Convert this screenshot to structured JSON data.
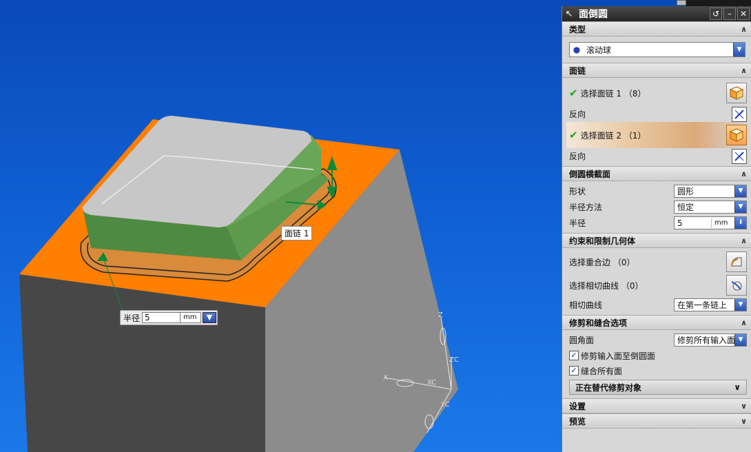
{
  "viewport": {
    "callout_label": "面链 1",
    "radius_label": "半径",
    "radius_value": "5",
    "radius_unit": "mm",
    "axis_labels": {
      "z": "Z",
      "zc": "ZC",
      "x": "X",
      "xc": "XC",
      "yc": "YC"
    },
    "colors": {
      "background": "#0f5fd2",
      "top_face": "#ff7f00",
      "front_face": "#4a4a4a",
      "side_face": "#8c8c8c",
      "selected_face": "#6aa657"
    }
  },
  "dialog": {
    "title": "面倒圆",
    "title_icons": [
      "pin-icon",
      "reset-icon",
      "minimize-icon",
      "close-icon"
    ],
    "sections": {
      "type": {
        "title": "类型",
        "value": "滚动球"
      },
      "face_chain": {
        "title": "面链",
        "select1": "选择面链 1 （8）",
        "reverse1": "反向",
        "select2": "选择面链 2 （1）",
        "reverse2": "反向"
      },
      "cross_section": {
        "title": "倒圆横截面",
        "shape_label": "形状",
        "shape_value": "圆形",
        "method_label": "半径方法",
        "method_value": "恒定",
        "radius_label": "半径",
        "radius_value": "5",
        "radius_unit": "mm"
      },
      "constraints": {
        "title": "约束和限制几何体",
        "coincident_edges": "选择重合边 （0）",
        "tangent_curves": "选择相切曲线 （0）",
        "tangent_label": "相切曲线",
        "tangent_value": "在第一条链上"
      },
      "trim": {
        "title": "修剪和缝合选项",
        "corner_label": "圆角面",
        "corner_value": "修剪所有输入面",
        "trim_inputs": "修剪输入面至倒圆面",
        "sew_all": "缝合所有面",
        "replace_title": "正在替代修剪对象"
      },
      "settings": {
        "title": "设置"
      },
      "preview": {
        "title": "预览"
      }
    }
  }
}
